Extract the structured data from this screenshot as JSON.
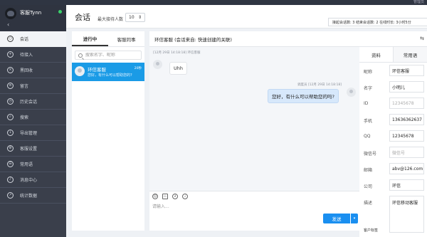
{
  "topbar": {
    "admin_label": "管理员"
  },
  "sidebar": {
    "user_name": "客服Tynn",
    "status_color": "#3ad16a",
    "collapse_icon": "‹",
    "items": [
      {
        "label": "会话",
        "icon": "chat-icon"
      },
      {
        "label": "待接入",
        "icon": "queue-icon"
      },
      {
        "label": "黑回收",
        "icon": "recycle-icon"
      },
      {
        "label": "留言",
        "icon": "message-icon"
      },
      {
        "label": "历史会话",
        "icon": "history-icon"
      },
      {
        "label": "搜索",
        "icon": "search-icon"
      },
      {
        "label": "导出管理",
        "icon": "export-icon"
      },
      {
        "label": "客服设置",
        "icon": "settings-icon"
      },
      {
        "label": "常用语",
        "icon": "phrases-icon"
      },
      {
        "label": "消息中心",
        "icon": "bell-icon"
      },
      {
        "label": "统计数据",
        "icon": "stats-icon"
      }
    ]
  },
  "header": {
    "title": "会话",
    "max_label": "最大接待人数",
    "max_value": "10",
    "stats": "接起会话数: 3   结束会话数: 2   在线时长: 3小时5分"
  },
  "list": {
    "tabs": [
      "进行中",
      "客服同事"
    ],
    "search_placeholder": "搜索名字、昵称",
    "conversations": [
      {
        "name": "环信客服",
        "time": "20秒",
        "preview": "您好，有什么可以帮助您的?"
      }
    ]
  },
  "chat": {
    "title": "环信客服 (会话来自: 快速创建的关联)",
    "messages": [
      {
        "meta": "[12月 29日 14:18:18] 环信客服",
        "text": "Uhh",
        "direction": "in"
      },
      {
        "meta": "调度员 [12月 29日 14:18:18]",
        "text": "您好，有什么可以帮助您的吗?",
        "direction": "out"
      }
    ],
    "input_placeholder": "请输入...",
    "send_label": "发送",
    "accent": "#1a8ff0"
  },
  "info": {
    "tabs": [
      "资料",
      "常用语"
    ],
    "fields": [
      {
        "label": "昵称",
        "value": "环信客服",
        "placeholder": false
      },
      {
        "label": "名字",
        "value": "小明儿",
        "placeholder": false
      },
      {
        "label": "ID",
        "value": "12345678",
        "placeholder": true
      },
      {
        "label": "手机",
        "value": "13636362637",
        "placeholder": false
      },
      {
        "label": "QQ",
        "value": "12345678",
        "placeholder": false
      },
      {
        "label": "微信号",
        "value": "微信号",
        "placeholder": true
      },
      {
        "label": "邮箱",
        "value": "abv@126.com",
        "placeholder": false
      },
      {
        "label": "公司",
        "value": "环信",
        "placeholder": false
      },
      {
        "label": "描述",
        "value": "环信移动客服",
        "placeholder": false
      }
    ],
    "customer_tag_label": "客户标签"
  }
}
